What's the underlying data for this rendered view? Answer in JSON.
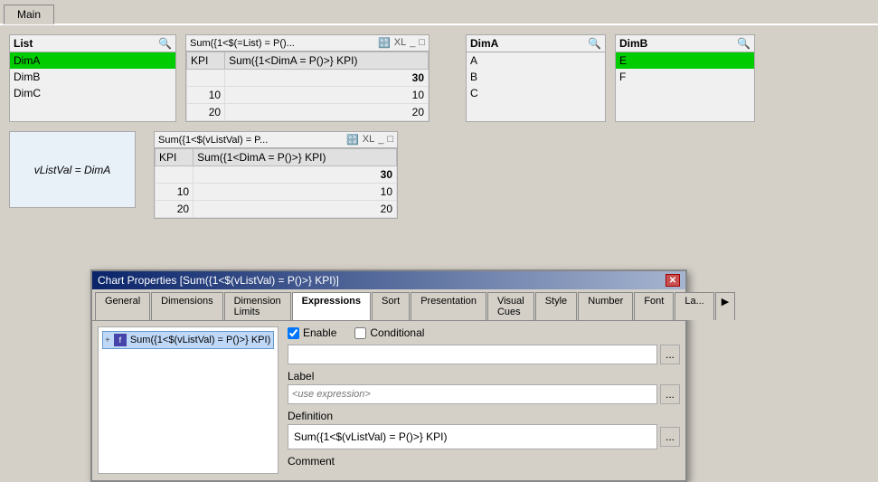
{
  "app": {
    "title": "Main"
  },
  "tabs": [
    {
      "label": "Main",
      "active": true
    }
  ],
  "list_panel": {
    "title": "List",
    "items": [
      {
        "label": "DimA",
        "selected": true
      },
      {
        "label": "DimB",
        "selected": false
      },
      {
        "label": "DimC",
        "selected": false
      }
    ]
  },
  "table_panel_1": {
    "title": "Sum({1<$(=List) = P()...",
    "col1": "KPI",
    "col2": "Sum({1<DimA = P()>} KPI)",
    "bold_value": "30",
    "rows": [
      {
        "c1": "10",
        "c2": "10"
      },
      {
        "c1": "20",
        "c2": "20"
      }
    ]
  },
  "dima_panel": {
    "title": "DimA",
    "items": [
      {
        "label": "A",
        "selected": false
      },
      {
        "label": "B",
        "selected": false
      },
      {
        "label": "C",
        "selected": false
      }
    ]
  },
  "dimb_panel": {
    "title": "DimB",
    "items": [
      {
        "label": "E",
        "selected": true
      },
      {
        "label": "F",
        "selected": false
      }
    ]
  },
  "table_panel_2": {
    "title": "Sum({1<$(vListVal) = P...",
    "col1": "KPI",
    "col2": "Sum({1<DimA = P()>} KPI)",
    "bold_value": "30",
    "rows": [
      {
        "c1": "10",
        "c2": "10"
      },
      {
        "c1": "20",
        "c2": "20"
      }
    ]
  },
  "vlistval_panel": {
    "label": "vListVal = DimA"
  },
  "modal": {
    "title": "Chart Properties [Sum({1<$(vListVal) = P()>} KPI)]",
    "close_label": "✕",
    "tabs": [
      {
        "label": "General",
        "active": false
      },
      {
        "label": "Dimensions",
        "active": false
      },
      {
        "label": "Dimension Limits",
        "active": false
      },
      {
        "label": "Expressions",
        "active": true
      },
      {
        "label": "Sort",
        "active": false
      },
      {
        "label": "Presentation",
        "active": false
      },
      {
        "label": "Visual Cues",
        "active": false
      },
      {
        "label": "Style",
        "active": false
      },
      {
        "label": "Number",
        "active": false
      },
      {
        "label": "Font",
        "active": false
      },
      {
        "label": "La...",
        "active": false
      }
    ],
    "expr_item": {
      "label": "Sum({1<$(vListVal) = P()>} KPI)"
    },
    "enable_label": "Enable",
    "conditional_label": "Conditional",
    "label_field_label": "Label",
    "label_placeholder": "<use expression>",
    "definition_label": "Definition",
    "definition_value": "Sum({1<$(vListVal) = P()>} KPI)",
    "comment_label": "Comment"
  }
}
